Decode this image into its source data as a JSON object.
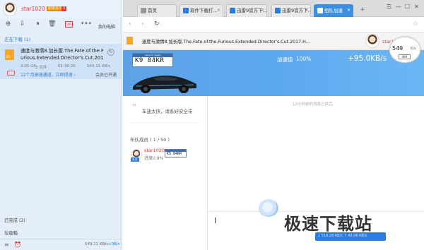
{
  "sidebar": {
    "user": {
      "name": "star1020",
      "badge1": "超级会员",
      "badge2": "V"
    },
    "toolbar": {
      "new_icon": "plus-icon",
      "dl_icon": "download-icon",
      "pause_icon": "pause-icon",
      "delete_icon": "trash-icon",
      "vip_label": "VIP",
      "more": "•••",
      "my_pc": "我的电脑"
    },
    "section_downloading": "正在下载 (1)",
    "task": {
      "file_badge": "BT",
      "name": "速度与激情8.加长版.The.Fate.of.the.Furious.Extended.Director's.Cut.2017.H...",
      "size": "3.05 GB",
      "percent_text": "2 文件",
      "time": "01:36:20",
      "speed": "549.11 KB/s",
      "progress_fraction": 0.02,
      "promo": "12个月高速通道，立即提速 ›",
      "member_open": "会员已开通"
    },
    "section_done": "已完成 (2)",
    "section_trash": "垃圾箱",
    "footer": {
      "speed_down": "549.11 KB/s",
      "speed_up": "+0B/s"
    }
  },
  "browser": {
    "tabs": [
      {
        "label": "首页",
        "icon_color": "#999999"
      },
      {
        "label": "软件下载打...",
        "icon_color": "#2d7de0"
      },
      {
        "label": "迅雷9官方下...",
        "icon_color": "#2d7de0"
      },
      {
        "label": "迅雷9官方下...",
        "icon_color": "#2d7de0"
      },
      {
        "label": "组队加速",
        "icon_color": "#ffffff"
      }
    ],
    "new_tab": "+",
    "window": {
      "menu": "☰",
      "min": "—",
      "max": "☐",
      "close": "✕"
    }
  },
  "team": {
    "task_title": "速度与激情8.加长版.The.Fate.of.the.Furious.Extended.Director's.Cut.2017.H...",
    "user_name": "star1020",
    "speed_widget": {
      "value": "549",
      "unit": "K/s",
      "badge": "4KR"
    },
    "plate": {
      "header": "need for speed",
      "number": "K9 84KR"
    },
    "booster_label": "加速值",
    "booster_percent": "100%",
    "booster_speed": "+95.0KB/s",
    "chat_note": "12小时前的消息已读完",
    "slogan": "车速太快，请系好安全带",
    "members_label": "车队成员 ( 1 / 50 )",
    "member": {
      "name": "star1020",
      "badge": "队长",
      "plate": "K9 84KR",
      "progress": "进度0.9%"
    }
  },
  "watermark": {
    "text": "极速下载站"
  },
  "status": {
    "send_text": "↓ 518.28 KB/s ↑ 42.98 KB/s"
  },
  "colors": {
    "accent": "#2d7de0",
    "hero": "#5ca8ef",
    "red": "#dd3333"
  }
}
